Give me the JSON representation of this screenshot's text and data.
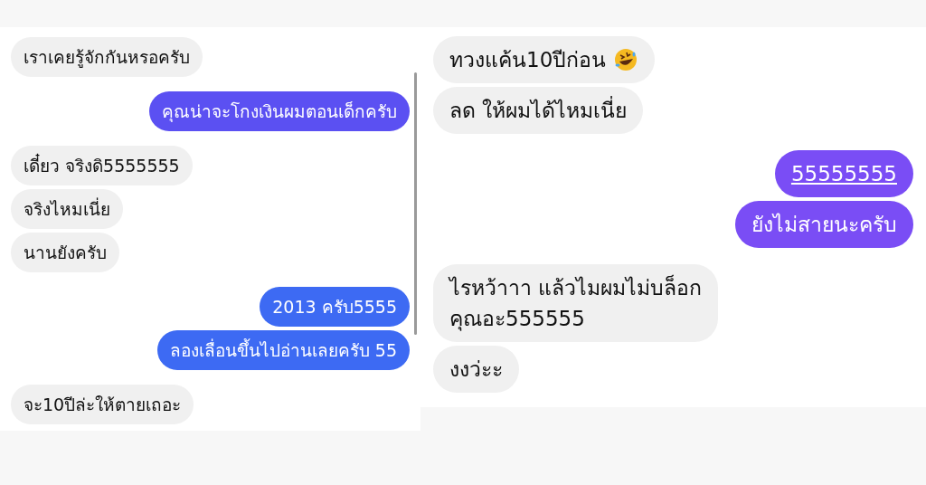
{
  "panels": [
    {
      "messages": [
        {
          "kind": "received",
          "text": "เราเคยรู้จักกันหรอครับ"
        },
        {
          "kind": "sent",
          "text": "คุณน่าจะโกงเงินผมตอนเด็กครับ",
          "color": "#5b50f2"
        },
        {
          "kind": "received",
          "text": "เดี๋ยว จริงดิ5555555"
        },
        {
          "kind": "received",
          "text": "จริงไหมเนี่ย"
        },
        {
          "kind": "received",
          "text": "นานยังครับ"
        },
        {
          "kind": "sent",
          "text": "2013 ครับ5555",
          "color": "#3d6af3"
        },
        {
          "kind": "sent",
          "text": "ลองเลื่อนขึ้นไปอ่านเลยครับ 55",
          "color": "#3d6af3"
        },
        {
          "kind": "received",
          "text": "จะ10ปีล่ะให้ตายเถอะ"
        }
      ]
    },
    {
      "messages": [
        {
          "kind": "received",
          "text": "ทวงแค้น10ปีก่อน",
          "emoji": true
        },
        {
          "kind": "received",
          "text": "ลด ให้ผมได้ไหมเนี่ย"
        },
        {
          "kind": "sent",
          "text": "55555555",
          "color": "#7a4df5",
          "link": true
        },
        {
          "kind": "sent",
          "text": "ยังไม่สายนะครับ",
          "color": "#7a4df5"
        },
        {
          "kind": "received",
          "text": "ไรหว้าาา แล้วไมผมไม่บล็อก\nคุณอะ555555"
        },
        {
          "kind": "received",
          "text": "งงว่ะะ"
        }
      ]
    }
  ]
}
